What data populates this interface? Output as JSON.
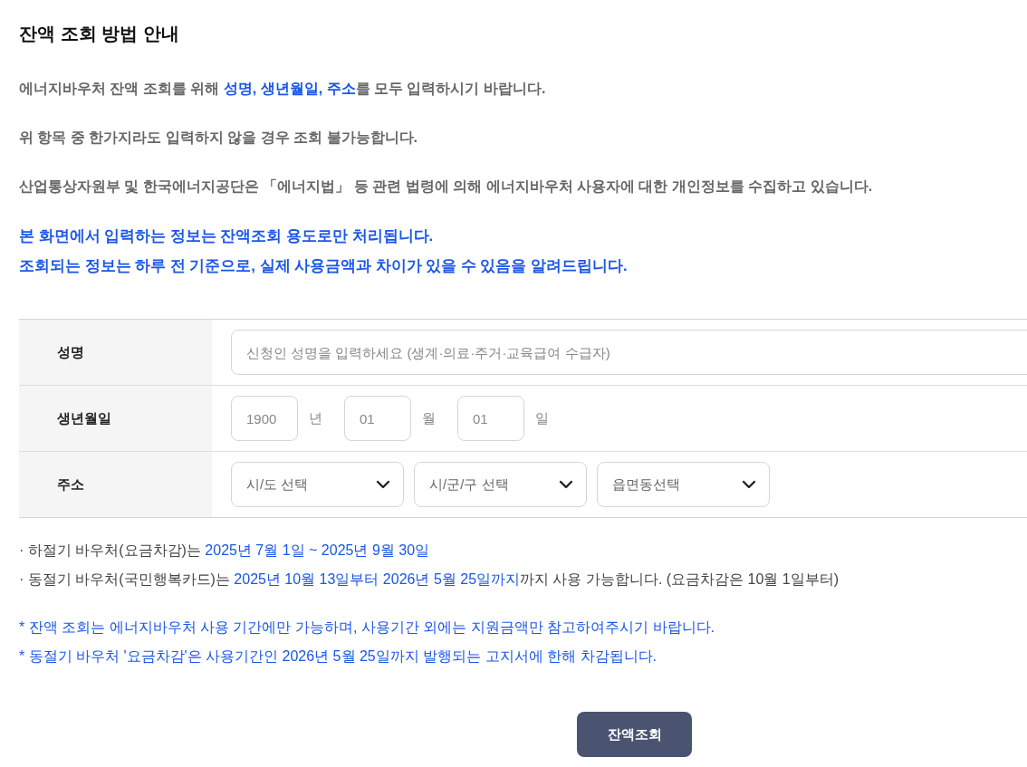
{
  "title": "잔액 조회 방법 안내",
  "intro": [
    {
      "segments": [
        {
          "text": "에너지바우처 잔액 조회를 위해 ",
          "highlight": false
        },
        {
          "text": "성명, 생년월일, 주소",
          "highlight": true
        },
        {
          "text": "를 모두 입력하시기 바랍니다.",
          "highlight": false
        }
      ]
    },
    {
      "segments": [
        {
          "text": "위 항목 중 한가지라도 입력하지 않을 경우 조회 불가능합니다.",
          "highlight": false
        }
      ]
    },
    {
      "segments": [
        {
          "text": "산업통상자원부 및 한국에너지공단은 「에너지법」 등 관련 법령에 의해 에너지바우처 사용자에 대한 개인정보를 수집하고 있습니다.",
          "highlight": false
        }
      ]
    }
  ],
  "notice": [
    "본 화면에서 입력하는 정보는 잔액조회 용도로만 처리됩니다.",
    "조회되는 정보는 하루 전 기준으로, 실제 사용금액과 차이가 있을 수 있음을 알려드립니다."
  ],
  "form": {
    "name": {
      "label": "성명",
      "placeholder": "신청인 성명을 입력하세요 (생계·의료·주거·교육급여 수급자)"
    },
    "birth": {
      "label": "생년월일",
      "fields": [
        {
          "placeholder": "1900",
          "unit": "년"
        },
        {
          "placeholder": "01",
          "unit": "월"
        },
        {
          "placeholder": "01",
          "unit": "일"
        }
      ]
    },
    "address": {
      "label": "주소",
      "selects": [
        {
          "placeholder": "시/도 선택"
        },
        {
          "placeholder": "시/군/구 선택"
        },
        {
          "placeholder": "읍면동선택"
        }
      ]
    }
  },
  "periods": [
    {
      "segments": [
        {
          "text": "· 하절기 바우처(요금차감)는 ",
          "highlight": false
        },
        {
          "text": "2025년 7월 1일 ~ 2025년 9월 30일",
          "highlight": true
        }
      ]
    },
    {
      "segments": [
        {
          "text": "· 동절기 바우처(국민행복카드)는 ",
          "highlight": false
        },
        {
          "text": "2025년 10월 13일부터 2026년 5월 25일까지",
          "highlight": true
        },
        {
          "text": "까지 사용 가능합니다. (요금차감은 10월 1일부터)",
          "highlight": false
        }
      ]
    }
  ],
  "notes": [
    "* 잔액 조회는 에너지바우처 사용 기간에만 가능하며, 사용기간 외에는 지원금액만 참고하여주시기 바랍니다.",
    "* 동절기 바우처 '요금차감'은 사용기간인 2026년 5월 25일까지 발행되는 고지서에 한해 차감됩니다."
  ],
  "button": "잔액조회"
}
